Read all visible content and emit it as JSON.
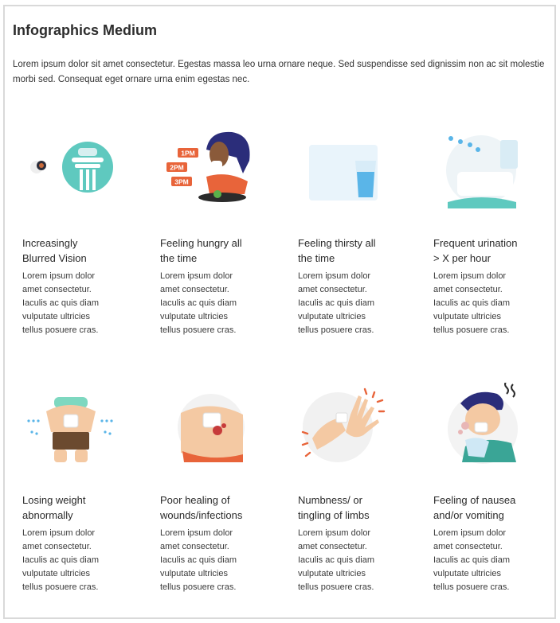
{
  "header": {
    "title": "Infographics Medium",
    "intro": "Lorem ipsum dolor sit amet consectetur. Egestas massa leo urna ornare neque. Sed suspendisse sed dignissim non ac sit molestie morbi sed. Consequat eget ornare urna enim egestas nec."
  },
  "cards": [
    {
      "line1": "Increasingly",
      "line2": "Blurred Vision",
      "icon": "blurred-vision-illustration"
    },
    {
      "line1": "Feeling hungry all",
      "line2": "the time",
      "icon": "hungry-illustration"
    },
    {
      "line1": "Feeling thirsty all",
      "line2": "the time",
      "icon": "thirsty-illustration"
    },
    {
      "line1": "Frequent urination",
      "line2": "> X per hour",
      "icon": "urination-illustration"
    },
    {
      "line1": "Losing weight",
      "line2": "abnormally",
      "icon": "weight-loss-illustration"
    },
    {
      "line1": "Poor healing of",
      "line2": "wounds/infections",
      "icon": "wound-illustration"
    },
    {
      "line1": "Numbness/ or",
      "line2": "tingling of limbs",
      "icon": "numbness-illustration"
    },
    {
      "line1": "Feeling of nausea",
      "line2": "and/or vomiting",
      "icon": "nausea-illustration"
    }
  ],
  "body_lines": [
    "Lorem ipsum dolor",
    "amet consectetur.",
    "Iaculis ac quis diam",
    "vulputate ultricies",
    "tellus posuere cras."
  ],
  "hungry_times": [
    "1PM",
    "2PM",
    "3PM"
  ],
  "colors": {
    "teal": "#5fc9bf",
    "orange": "#e8643a",
    "navy": "#2b2d7a",
    "skin": "#f4c9a3",
    "blue": "#5ab5e8"
  }
}
